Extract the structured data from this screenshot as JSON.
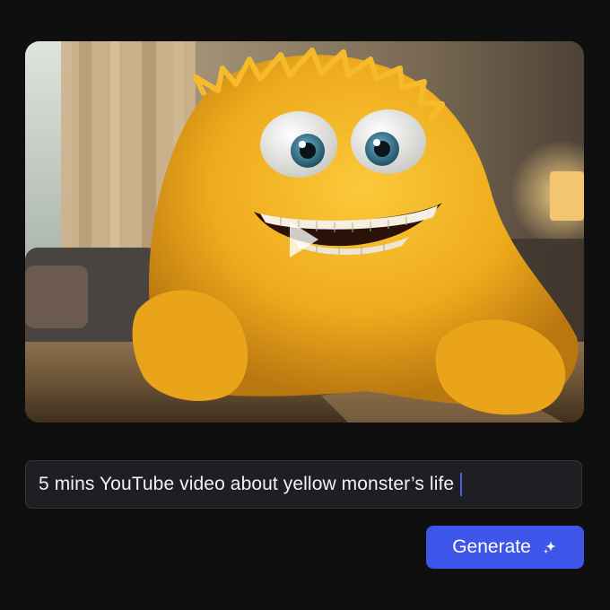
{
  "video": {
    "description_icon": "play-icon"
  },
  "prompt": {
    "value": "5 mins YouTube video about yellow monster’s life"
  },
  "actions": {
    "generate_label": "Generate",
    "generate_icon": "sparkle-icon"
  },
  "colors": {
    "background": "#0f0f10",
    "input_background": "#1e1f22",
    "accent": "#3d55e8",
    "caret": "#4a5cf0",
    "monster_fur": "#f0b41e"
  }
}
